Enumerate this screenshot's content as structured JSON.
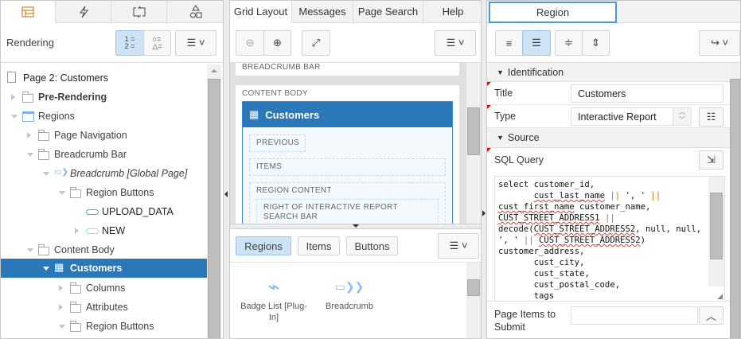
{
  "left": {
    "tabs": [
      {
        "icon": "rendering-tree-icon"
      },
      {
        "icon": "dynamic-actions-icon"
      },
      {
        "icon": "processing-icon"
      },
      {
        "icon": "shared-components-icon"
      }
    ],
    "title": "Rendering",
    "tree": [
      {
        "label": "Page 2: Customers",
        "level": 0
      },
      {
        "label": "Pre-Rendering",
        "level": 1,
        "bold": true
      },
      {
        "label": "Regions",
        "level": 1
      },
      {
        "label": "Page Navigation",
        "level": 2
      },
      {
        "label": "Breadcrumb Bar",
        "level": 2
      },
      {
        "label": "Breadcrumb [Global Page]",
        "level": 3,
        "italic": true
      },
      {
        "label": "Region Buttons",
        "level": 4
      },
      {
        "label": "UPLOAD_DATA",
        "level": 5
      },
      {
        "label": "NEW",
        "level": 5
      },
      {
        "label": "Content Body",
        "level": 2
      },
      {
        "label": "Customers",
        "level": 3,
        "selected": true
      },
      {
        "label": "Columns",
        "level": 4
      },
      {
        "label": "Attributes",
        "level": 4
      },
      {
        "label": "Region Buttons",
        "level": 4
      }
    ]
  },
  "middle": {
    "tabs": [
      "Grid Layout",
      "Messages",
      "Page Search",
      "Help"
    ],
    "canvas": {
      "breadcrumb_bar": "BREADCRUMB BAR",
      "content_body": "CONTENT BODY",
      "region_title": "Customers",
      "slots": [
        "PREVIOUS",
        "ITEMS",
        "REGION CONTENT",
        "RIGHT OF INTERACTIVE REPORT SEARCH BAR"
      ]
    },
    "gallery": {
      "tabs": [
        "Regions",
        "Items",
        "Buttons"
      ],
      "items": [
        "Badge List [Plug-In]",
        "Breadcrumb"
      ]
    }
  },
  "right": {
    "tab": "Region",
    "sections": {
      "identification": "Identification",
      "source": "Source"
    },
    "title_label": "Title",
    "title_value": "Customers",
    "type_label": "Type",
    "type_value": "Interactive Report",
    "sql_label": "SQL Query",
    "sql_lines": [
      "select customer_id,",
      "       cust_last_name || ', ' ||",
      "cust_first_name customer_name,",
      "CUST_STREET_ADDRESS1 ||",
      "decode(CUST_STREET_ADDRESS2, null, null,",
      "', ' || CUST_STREET_ADDRESS2)",
      "customer_address,",
      "       cust_city,",
      "       cust_state,",
      "       cust_postal_code,",
      "       tags"
    ],
    "page_items_label": "Page Items to Submit",
    "page_items_value": ""
  },
  "colors": {
    "accent": "#2b78b8",
    "selected_button": "#cfe3f7"
  }
}
